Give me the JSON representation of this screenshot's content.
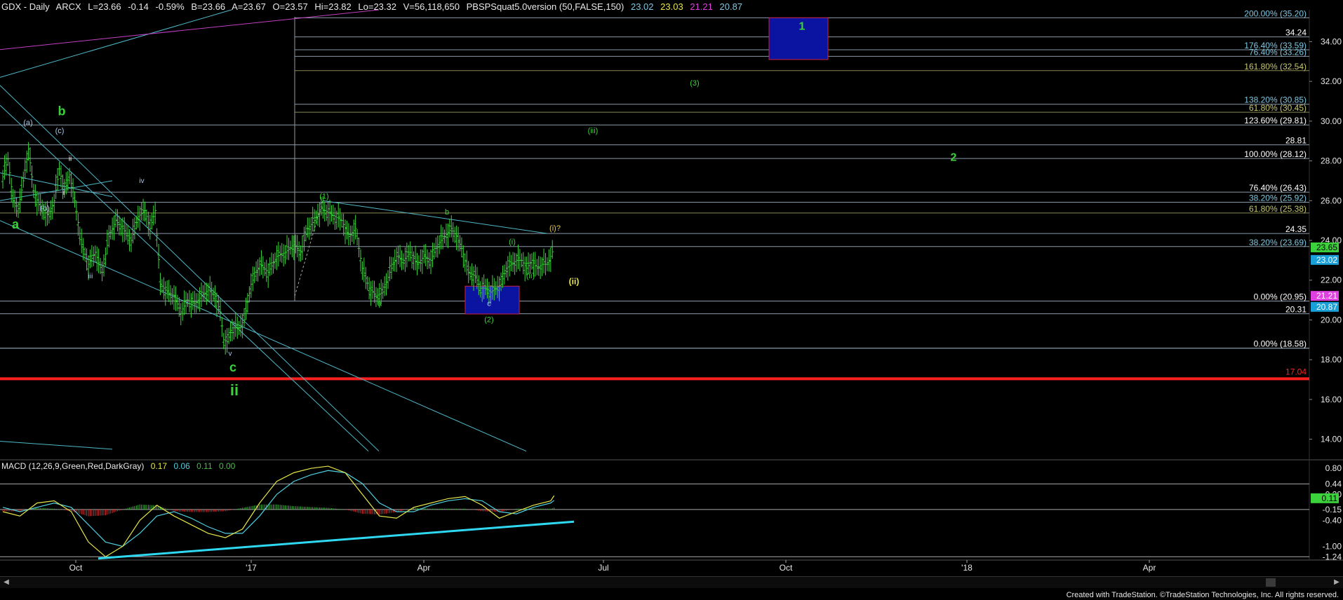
{
  "header": {
    "symbol": "GDX - Daily",
    "exchange": "ARCX",
    "last": "L=23.66",
    "change": "-0.14",
    "change_pct": "-0.59%",
    "bid": "B=23.66",
    "ask": "A=23.67",
    "open": "O=23.57",
    "high": "Hi=23.82",
    "low": "Lo=23.32",
    "volume": "V=56,118,650",
    "indicator": "PBSPSquat5.0version (50,FALSE,150)",
    "ind_values": [
      "23.02",
      "23.03",
      "21.21",
      "20.87"
    ],
    "ind_colors": [
      "#7ec8e3",
      "#e6e64a",
      "#e040e0",
      "#7ec8e3"
    ]
  },
  "macd_header": {
    "label": "MACD (12,26,9,Green,Red,DarkGray)",
    "values": [
      "0.17",
      "0.06",
      "0.11",
      "0.00"
    ],
    "colors": [
      "#e6e64a",
      "#4fd0e0",
      "#40c040",
      "#40c040"
    ]
  },
  "footer": "Created with TradeStation. ©TradeStation Technologies, Inc. All rights reserved.",
  "colors": {
    "up_bar": "#3cd23c",
    "price_axis": "#ffffff",
    "fib_cyan": "#7ec8e3",
    "fib_yellow": "#c8c86e",
    "support_red": "#ff2020",
    "channel": "#4fb8c8",
    "macd_fast": "#e6e64a",
    "macd_slow": "#4fd0e0",
    "macd_up": "#3cb43c",
    "macd_down": "#d23232",
    "trend_line": "#2ed8f0"
  },
  "chart_data": {
    "type": "candlestick",
    "title": "GDX - Daily",
    "x_labels": [
      "Oct",
      "'17",
      "Apr",
      "Jul",
      "Oct",
      "'18",
      "Apr"
    ],
    "y_ticks": [
      "34.00",
      "32.00",
      "30.00",
      "28.00",
      "26.00",
      "24.00",
      "22.00",
      "20.00",
      "18.00",
      "16.00",
      "14.00"
    ],
    "ylim": [
      13.0,
      35.6
    ],
    "price_path": [
      [
        0,
        27.2
      ],
      [
        6,
        28.1
      ],
      [
        12,
        26.0
      ],
      [
        18,
        25.6
      ],
      [
        24,
        27.0
      ],
      [
        30,
        28.6
      ],
      [
        36,
        26.5
      ],
      [
        42,
        25.8
      ],
      [
        48,
        25.5
      ],
      [
        54,
        25.2
      ],
      [
        60,
        26.0
      ],
      [
        66,
        27.6
      ],
      [
        72,
        26.5
      ],
      [
        78,
        27.3
      ],
      [
        84,
        26.0
      ],
      [
        92,
        23.8
      ],
      [
        100,
        22.8
      ],
      [
        108,
        23.4
      ],
      [
        116,
        22.4
      ],
      [
        124,
        24.2
      ],
      [
        132,
        25.0
      ],
      [
        140,
        24.6
      ],
      [
        150,
        24.0
      ],
      [
        158,
        25.2
      ],
      [
        166,
        25.5
      ],
      [
        172,
        24.6
      ],
      [
        178,
        25.5
      ],
      [
        184,
        21.8
      ],
      [
        192,
        21.4
      ],
      [
        200,
        21.2
      ],
      [
        208,
        20.4
      ],
      [
        216,
        21.0
      ],
      [
        224,
        20.8
      ],
      [
        232,
        21.2
      ],
      [
        240,
        21.5
      ],
      [
        248,
        21.2
      ],
      [
        254,
        20.4
      ],
      [
        258,
        19.0
      ],
      [
        262,
        18.9
      ],
      [
        268,
        19.6
      ],
      [
        276,
        19.6
      ],
      [
        282,
        20.0
      ],
      [
        290,
        21.8
      ],
      [
        300,
        22.8
      ],
      [
        310,
        22.4
      ],
      [
        320,
        23.2
      ],
      [
        330,
        23.4
      ],
      [
        340,
        23.8
      ],
      [
        348,
        23.4
      ],
      [
        356,
        24.6
      ],
      [
        364,
        25.0
      ],
      [
        372,
        25.6
      ],
      [
        380,
        25.4
      ],
      [
        388,
        25.2
      ],
      [
        396,
        25.0
      ],
      [
        404,
        24.2
      ],
      [
        412,
        24.6
      ],
      [
        420,
        22.6
      ],
      [
        428,
        21.6
      ],
      [
        436,
        21.2
      ],
      [
        444,
        21.4
      ],
      [
        452,
        22.4
      ],
      [
        460,
        23.2
      ],
      [
        468,
        23.0
      ],
      [
        476,
        23.4
      ],
      [
        484,
        22.8
      ],
      [
        492,
        23.2
      ],
      [
        500,
        23.0
      ],
      [
        508,
        23.8
      ],
      [
        516,
        24.2
      ],
      [
        524,
        24.6
      ],
      [
        530,
        24.2
      ],
      [
        536,
        23.6
      ],
      [
        544,
        22.4
      ],
      [
        552,
        22.2
      ],
      [
        558,
        21.6
      ],
      [
        564,
        21.6
      ],
      [
        570,
        21.4
      ],
      [
        576,
        21.6
      ],
      [
        582,
        21.8
      ],
      [
        588,
        22.6
      ],
      [
        594,
        22.8
      ],
      [
        600,
        23.0
      ],
      [
        606,
        23.0
      ],
      [
        612,
        22.6
      ],
      [
        618,
        23.0
      ],
      [
        624,
        22.6
      ],
      [
        630,
        22.8
      ],
      [
        636,
        22.8
      ],
      [
        640,
        23.2
      ],
      [
        644,
        23.66
      ]
    ],
    "fib_levels": [
      {
        "label": "200.00% (35.20)",
        "price": 35.2,
        "color": "#7ec8e3"
      },
      {
        "label": "34.24",
        "price": 34.24,
        "color": "#ffffff"
      },
      {
        "label": "176.40% (33.59)",
        "price": 33.59,
        "color": "#7ec8e3"
      },
      {
        "label": "76.40% (33.26)",
        "price": 33.26,
        "color": "#7ec8e3"
      },
      {
        "label": "161.80% (32.54)",
        "price": 32.54,
        "color": "#c8c86e"
      },
      {
        "label": "138.20% (30.85)",
        "price": 30.85,
        "color": "#7ec8e3"
      },
      {
        "label": "61.80% (30.45)",
        "price": 30.45,
        "color": "#c8c86e"
      },
      {
        "label": "123.60% (29.81)",
        "price": 29.81,
        "color": "#ffffff"
      },
      {
        "label": "28.81",
        "price": 28.81,
        "color": "#ffffff"
      },
      {
        "label": "100.00% (28.12)",
        "price": 28.12,
        "color": "#ffffff"
      },
      {
        "label": "76.40% (26.43)",
        "price": 26.43,
        "color": "#ffffff"
      },
      {
        "label": "38.20% (25.92)",
        "price": 25.92,
        "color": "#7ec8e3"
      },
      {
        "label": "61.80% (25.38)",
        "price": 25.38,
        "color": "#c8c86e"
      },
      {
        "label": "24.35",
        "price": 24.35,
        "color": "#ffffff"
      },
      {
        "label": "38.20% (23.69)",
        "price": 23.69,
        "color": "#7ec8e3"
      },
      {
        "label": "0.00% (20.95)",
        "price": 20.95,
        "color": "#ffffff"
      },
      {
        "label": "20.31",
        "price": 20.31,
        "color": "#ffffff"
      },
      {
        "label": "18.58",
        "price": 18.58,
        "color": "#ffffff"
      },
      {
        "label": "0.00% (18.58)",
        "price": 18.58,
        "color": "#ffffff"
      }
    ],
    "support_line": {
      "label": "17.04",
      "price": 17.04,
      "color": "#ff2020"
    },
    "price_tags": [
      {
        "label": "23.65",
        "price": 23.65,
        "bg": "#3cd23c",
        "fg": "#000000"
      },
      {
        "label": "23.02",
        "price": 23.02,
        "bg": "#1aa0d8",
        "fg": "#ffffff"
      },
      {
        "label": "21.21",
        "price": 21.21,
        "bg": "#e040e0",
        "fg": "#ffffff"
      },
      {
        "label": "20.87",
        "price": 20.87,
        "bg": "#1aa0d8",
        "fg": "#ffffff"
      }
    ],
    "wave_labels": [
      {
        "text": "1",
        "price": 34.6,
        "color": "#3cd23c",
        "bold": true,
        "size": 16
      },
      {
        "text": "(3)",
        "price": 31.8,
        "color": "#3cd23c",
        "bold": false,
        "size": 11
      },
      {
        "text": "(iii)",
        "price": 29.4,
        "color": "#3cd23c",
        "bold": false,
        "size": 11
      },
      {
        "text": "2",
        "price": 28.0,
        "color": "#3cd23c",
        "bold": true,
        "size": 16
      },
      {
        "text": "b",
        "price": 30.3,
        "color": "#3cd23c",
        "bold": true,
        "size": 18
      },
      {
        "text": "(a)",
        "price": 29.8,
        "color": "#a8c8e8",
        "bold": false,
        "size": 11
      },
      {
        "text": "(c)",
        "price": 29.4,
        "color": "#a8c8e8",
        "bold": false,
        "size": 11
      },
      {
        "text": "ii",
        "price": 28.0,
        "color": "#ffffff",
        "bold": false,
        "size": 10
      },
      {
        "text": "i",
        "price": 26.3,
        "color": "#ffffff",
        "bold": false,
        "size": 10
      },
      {
        "text": "iv",
        "price": 26.9,
        "color": "#a8c8e8",
        "bold": false,
        "size": 10
      },
      {
        "text": "(b)",
        "price": 25.5,
        "color": "#a8c8e8",
        "bold": false,
        "size": 11
      },
      {
        "text": "a",
        "price": 24.6,
        "color": "#3cd23c",
        "bold": true,
        "size": 18
      },
      {
        "text": "iii",
        "price": 22.1,
        "color": "#a8c8e8",
        "bold": false,
        "size": 10
      },
      {
        "text": "v",
        "price": 18.2,
        "color": "#a8c8e8",
        "bold": false,
        "size": 10
      },
      {
        "text": "c",
        "price": 17.4,
        "color": "#3cd23c",
        "bold": true,
        "size": 18
      },
      {
        "text": "ii",
        "price": 16.2,
        "color": "#3cd23c",
        "bold": true,
        "size": 22
      },
      {
        "text": "(1)",
        "price": 26.1,
        "color": "#3cd23c",
        "bold": false,
        "size": 11
      },
      {
        "text": "b",
        "price": 25.3,
        "color": "#3cd23c",
        "bold": false,
        "size": 11
      },
      {
        "text": "(i)?",
        "price": 24.5,
        "color": "#e6c84a",
        "bold": false,
        "size": 11
      },
      {
        "text": "(i)",
        "price": 23.8,
        "color": "#3cd23c",
        "bold": false,
        "size": 11
      },
      {
        "text": "(ii)",
        "price": 22.1,
        "color": "#3cd23c",
        "bold": false,
        "size": 11
      },
      {
        "text": "(ii)",
        "price": 21.8,
        "color": "#e6e64a",
        "bold": true,
        "size": 12
      },
      {
        "text": "a",
        "price": 20.7,
        "color": "#3cd23c",
        "bold": false,
        "size": 11
      },
      {
        "text": "c",
        "price": 20.7,
        "color": "#a8c8e8",
        "bold": false,
        "size": 11
      },
      {
        "text": "(2)",
        "price": 19.9,
        "color": "#3cd23c",
        "bold": false,
        "size": 11
      }
    ],
    "target_boxes": [
      {
        "label": "wave-1-target-box",
        "price_top": 35.2,
        "price_bottom": 33.1
      },
      {
        "label": "wave-2-target-box",
        "price_top": 21.7,
        "price_bottom": 20.3
      }
    ],
    "macd": {
      "y_ticks": [
        "0.80",
        "0.44",
        "0.20",
        "-0.15",
        "-0.40",
        "-1.00",
        "-1.24"
      ],
      "ylim": [
        -1.3,
        0.9
      ],
      "highlight": [
        {
          "label": "0.44",
          "value": 0.44,
          "box": false
        },
        {
          "label": "-0.15",
          "value": -0.15,
          "box": false
        },
        {
          "label": "-1.24",
          "value": -1.24,
          "box": false
        }
      ],
      "tags": [
        {
          "label": "0.11",
          "value": 0.11,
          "bg": "#3cd23c",
          "fg": "#000000"
        }
      ],
      "fast": [
        [
          0,
          -0.2
        ],
        [
          20,
          -0.3
        ],
        [
          40,
          0.0
        ],
        [
          60,
          0.05
        ],
        [
          80,
          -0.2
        ],
        [
          100,
          -0.9
        ],
        [
          120,
          -1.24
        ],
        [
          140,
          -1.0
        ],
        [
          160,
          -0.4
        ],
        [
          180,
          -0.05
        ],
        [
          200,
          -0.3
        ],
        [
          220,
          -0.5
        ],
        [
          240,
          -0.7
        ],
        [
          260,
          -0.8
        ],
        [
          280,
          -0.6
        ],
        [
          300,
          0.0
        ],
        [
          320,
          0.5
        ],
        [
          340,
          0.7
        ],
        [
          360,
          0.8
        ],
        [
          380,
          0.85
        ],
        [
          400,
          0.7
        ],
        [
          420,
          0.2
        ],
        [
          440,
          -0.3
        ],
        [
          460,
          -0.35
        ],
        [
          480,
          -0.1
        ],
        [
          500,
          0.0
        ],
        [
          520,
          0.1
        ],
        [
          540,
          0.15
        ],
        [
          560,
          -0.05
        ],
        [
          580,
          -0.35
        ],
        [
          600,
          -0.2
        ],
        [
          620,
          -0.05
        ],
        [
          640,
          0.05
        ],
        [
          644,
          0.17
        ]
      ],
      "slow": [
        [
          0,
          -0.1
        ],
        [
          20,
          -0.2
        ],
        [
          40,
          -0.1
        ],
        [
          60,
          0.0
        ],
        [
          80,
          -0.1
        ],
        [
          100,
          -0.5
        ],
        [
          120,
          -0.9
        ],
        [
          140,
          -1.0
        ],
        [
          160,
          -0.7
        ],
        [
          180,
          -0.3
        ],
        [
          200,
          -0.2
        ],
        [
          220,
          -0.35
        ],
        [
          240,
          -0.55
        ],
        [
          260,
          -0.7
        ],
        [
          280,
          -0.7
        ],
        [
          300,
          -0.3
        ],
        [
          320,
          0.2
        ],
        [
          340,
          0.5
        ],
        [
          360,
          0.65
        ],
        [
          380,
          0.75
        ],
        [
          400,
          0.7
        ],
        [
          420,
          0.45
        ],
        [
          440,
          0.0
        ],
        [
          460,
          -0.2
        ],
        [
          480,
          -0.2
        ],
        [
          500,
          -0.05
        ],
        [
          520,
          0.05
        ],
        [
          540,
          0.1
        ],
        [
          560,
          0.05
        ],
        [
          580,
          -0.2
        ],
        [
          600,
          -0.25
        ],
        [
          620,
          -0.1
        ],
        [
          640,
          0.0
        ],
        [
          644,
          0.06
        ]
      ]
    }
  }
}
